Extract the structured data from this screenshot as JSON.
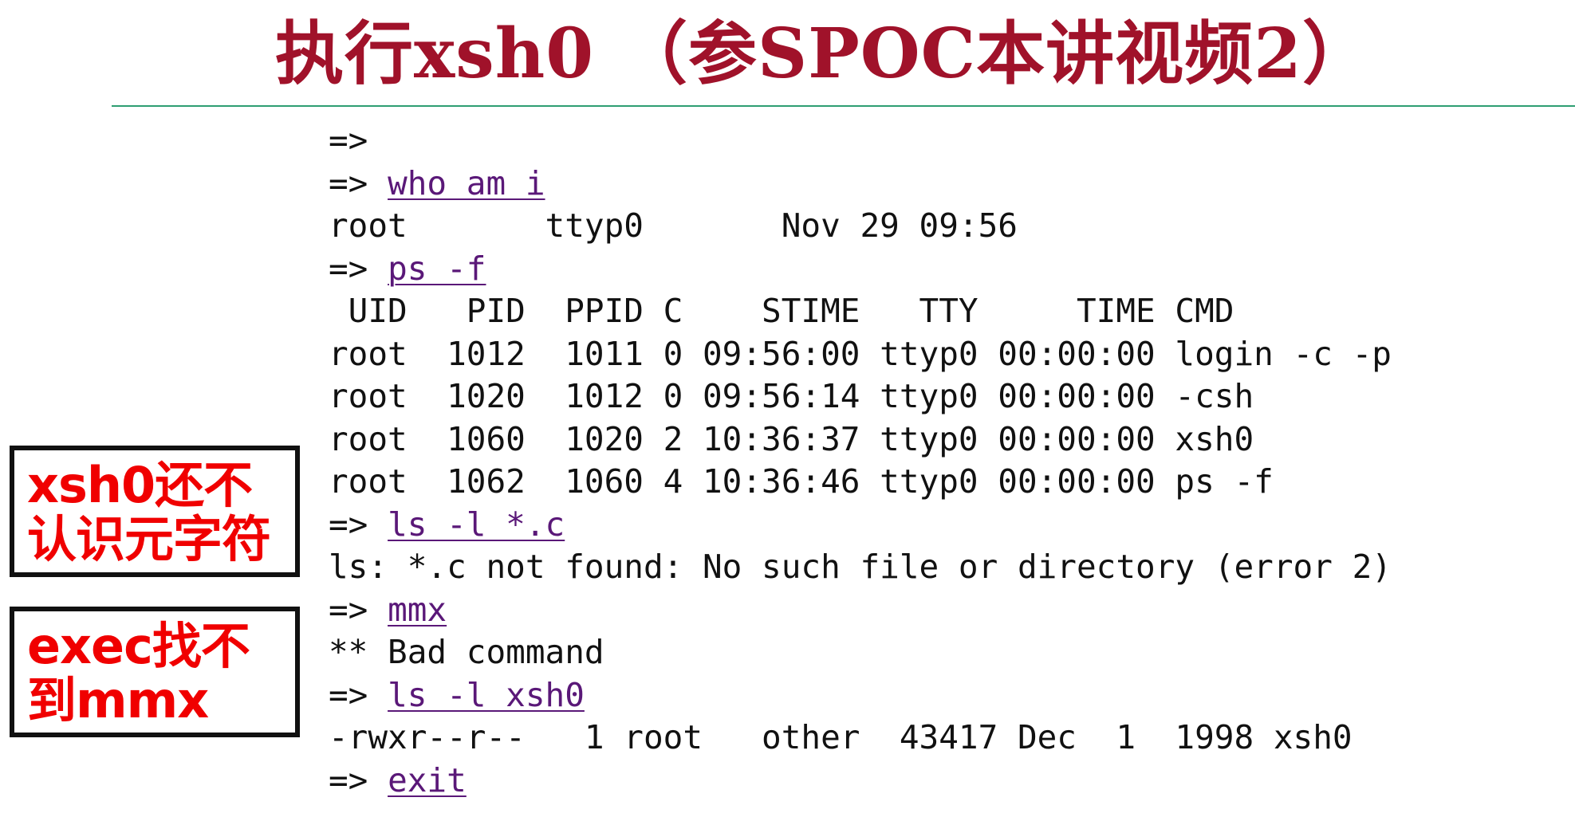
{
  "title": "执行xsh0 （参SPOC本讲视频2）",
  "colors": {
    "title": "#a0122a",
    "rule": "#2e9e72",
    "command": "#5a1878",
    "note_text": "#f00000",
    "note_border": "#111111"
  },
  "terminal": {
    "prompt": "=>",
    "lines": [
      {
        "type": "prompt",
        "cmd": ""
      },
      {
        "type": "prompt",
        "cmd": "who am i"
      },
      {
        "type": "output",
        "text": "root       ttyp0       Nov 29 09:56"
      },
      {
        "type": "prompt",
        "cmd": "ps -f"
      },
      {
        "type": "output",
        "text": " UID   PID  PPID C    STIME   TTY     TIME CMD"
      },
      {
        "type": "output",
        "text": "root  1012  1011 0 09:56:00 ttyp0 00:00:00 login -c -p"
      },
      {
        "type": "output",
        "text": "root  1020  1012 0 09:56:14 ttyp0 00:00:00 -csh"
      },
      {
        "type": "output",
        "text": "root  1060  1020 2 10:36:37 ttyp0 00:00:00 xsh0"
      },
      {
        "type": "output",
        "text": "root  1062  1060 4 10:36:46 ttyp0 00:00:00 ps -f"
      },
      {
        "type": "prompt",
        "cmd": "ls -l *.c"
      },
      {
        "type": "output",
        "text": "ls: *.c not found: No such file or directory (error 2)"
      },
      {
        "type": "prompt",
        "cmd": "mmx"
      },
      {
        "type": "output",
        "text": "** Bad command"
      },
      {
        "type": "prompt",
        "cmd": "ls -l xsh0"
      },
      {
        "type": "output",
        "text": "-rwxr--r--   1 root   other  43417 Dec  1  1998 xsh0"
      },
      {
        "type": "prompt",
        "cmd": "exit"
      }
    ]
  },
  "notes": [
    {
      "lines": [
        "xsh0还不",
        "认识元字符"
      ]
    },
    {
      "lines": [
        "exec找不",
        "到mmx"
      ]
    }
  ]
}
